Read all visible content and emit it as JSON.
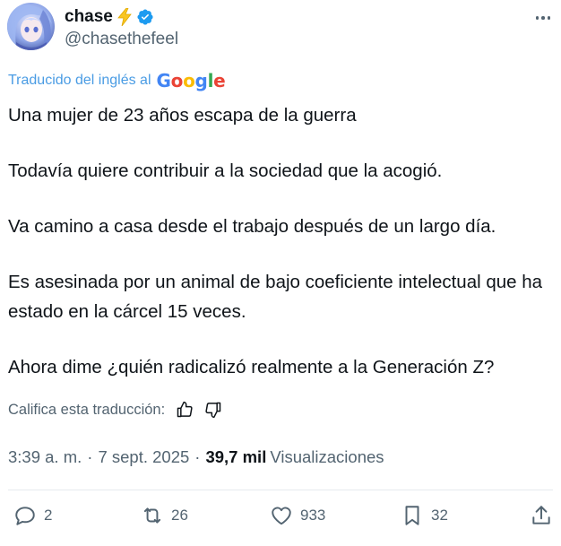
{
  "user": {
    "display_name": "chase",
    "handle": "@chasethefeel",
    "emoji": "lightning-bolt",
    "verified": true
  },
  "translation": {
    "label": "Traducido del inglés al",
    "provider": "Google"
  },
  "tweet": {
    "paragraphs": [
      "Una mujer de 23 años escapa de la guerra",
      "Todavía quiere contribuir a la sociedad que la acogió.",
      "Va camino a casa desde el trabajo después de un largo día.",
      "Es asesinada por un animal de bajo coeficiente intelectual que ha estado en la cárcel 15 veces.",
      "Ahora dime ¿quién radicalizó realmente a la Generación Z?"
    ]
  },
  "rating": {
    "label": "Califica esta traducción:"
  },
  "meta": {
    "time": "3:39 a. m.",
    "dot": "·",
    "date": "7 sept. 2025",
    "views_count": "39,7 mil",
    "views_label": "Visualizaciones"
  },
  "actions": {
    "replies": "2",
    "reposts": "26",
    "likes": "933",
    "bookmarks": "32"
  },
  "colors": {
    "text": "#0f1419",
    "muted": "#536471",
    "link": "#4a9ce4",
    "verified": "#1d9bf0",
    "bolt": "#f9c623"
  }
}
